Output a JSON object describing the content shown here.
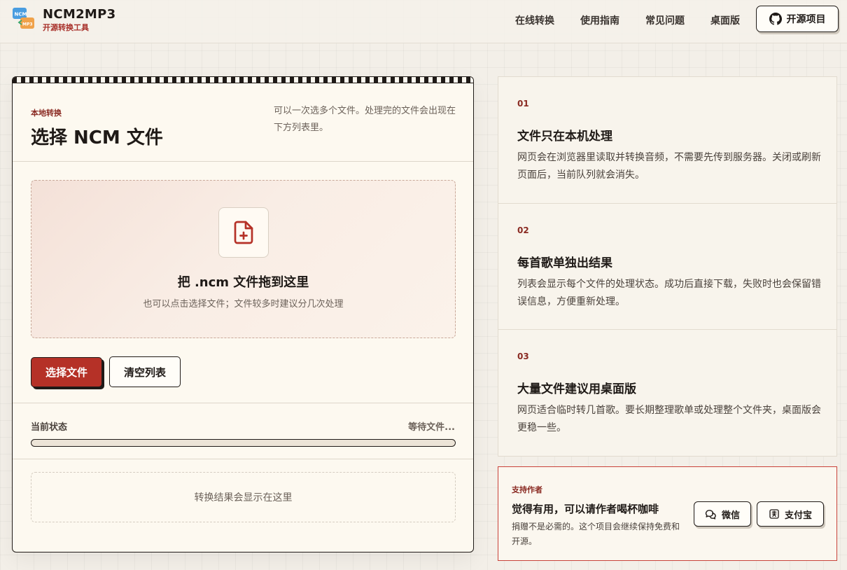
{
  "header": {
    "brand_title": "NCM2MP3",
    "brand_subtitle": "开源转换工具",
    "nav": [
      "在线转换",
      "使用指南",
      "常见问题",
      "桌面版"
    ],
    "github_button": "开源项目"
  },
  "converter": {
    "eyebrow": "本地转换",
    "title": "选择 NCM 文件",
    "description": "可以一次选多个文件。处理完的文件会出现在下方列表里。",
    "dropzone_title": "把 .ncm 文件拖到这里",
    "dropzone_subtitle": "也可以点击选择文件；文件较多时建议分几次处理",
    "select_button": "选择文件",
    "clear_button": "清空列表",
    "status_label": "当前状态",
    "status_value": "等待文件...",
    "progress": 0,
    "results_placeholder": "转换结果会显示在这里"
  },
  "features": [
    {
      "num": "01",
      "title": "文件只在本机处理",
      "body": "网页会在浏览器里读取并转换音频，不需要先传到服务器。关闭或刷新页面后，当前队列就会消失。"
    },
    {
      "num": "02",
      "title": "每首歌单独出结果",
      "body": "列表会显示每个文件的处理状态。成功后直接下载，失败时也会保留错误信息，方便重新处理。"
    },
    {
      "num": "03",
      "title": "大量文件建议用桌面版",
      "body": "网页适合临时转几首歌。要长期整理歌单或处理整个文件夹，桌面版会更稳一些。"
    }
  ],
  "support": {
    "eyebrow": "支持作者",
    "title": "觉得有用，可以请作者喝杯咖啡",
    "body": "捐赠不是必需的。这个项目会继续保持免费和开源。",
    "wechat_button": "微信",
    "alipay_button": "支付宝"
  },
  "colors": {
    "accent": "#b53127",
    "ink": "#1f1a17",
    "paper": "#fdf9f0"
  }
}
